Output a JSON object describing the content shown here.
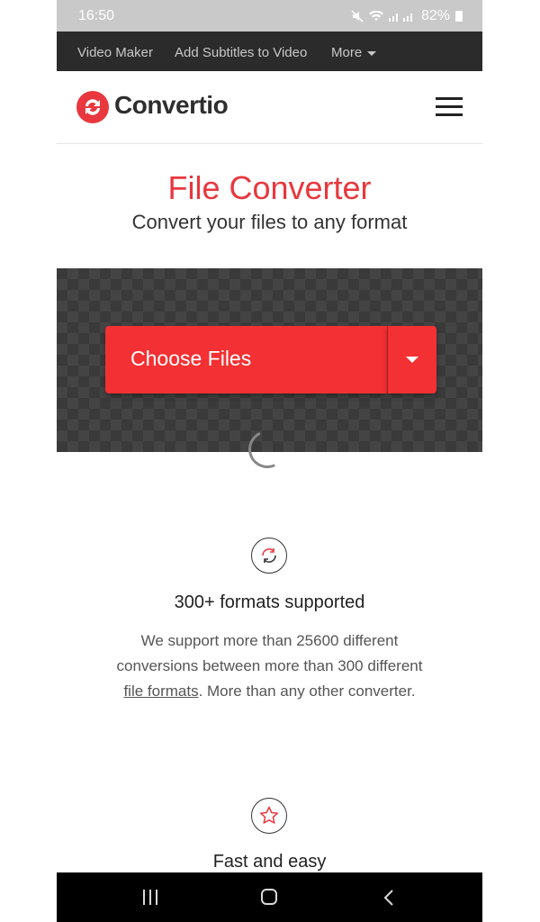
{
  "status_bar": {
    "time": "16:50",
    "battery": "82%"
  },
  "topnav": {
    "items": [
      "Video Maker",
      "Add Subtitles to Video",
      "More"
    ]
  },
  "header": {
    "brand": "Convertio"
  },
  "hero": {
    "title": "File Converter",
    "subtitle": "Convert your files to any format"
  },
  "upload": {
    "choose_label": "Choose Files"
  },
  "features": [
    {
      "icon": "refresh-icon",
      "title": "300+ formats supported",
      "desc_before": "We support more than 25600 different conversions between more than 300 different ",
      "desc_link": "file formats",
      "desc_after": ". More than any other converter."
    },
    {
      "icon": "star-icon",
      "title": "Fast and easy"
    }
  ],
  "colors": {
    "brand_red": "#e8373e",
    "button_red": "#f33033",
    "nav_dark": "#2b2b2b"
  }
}
